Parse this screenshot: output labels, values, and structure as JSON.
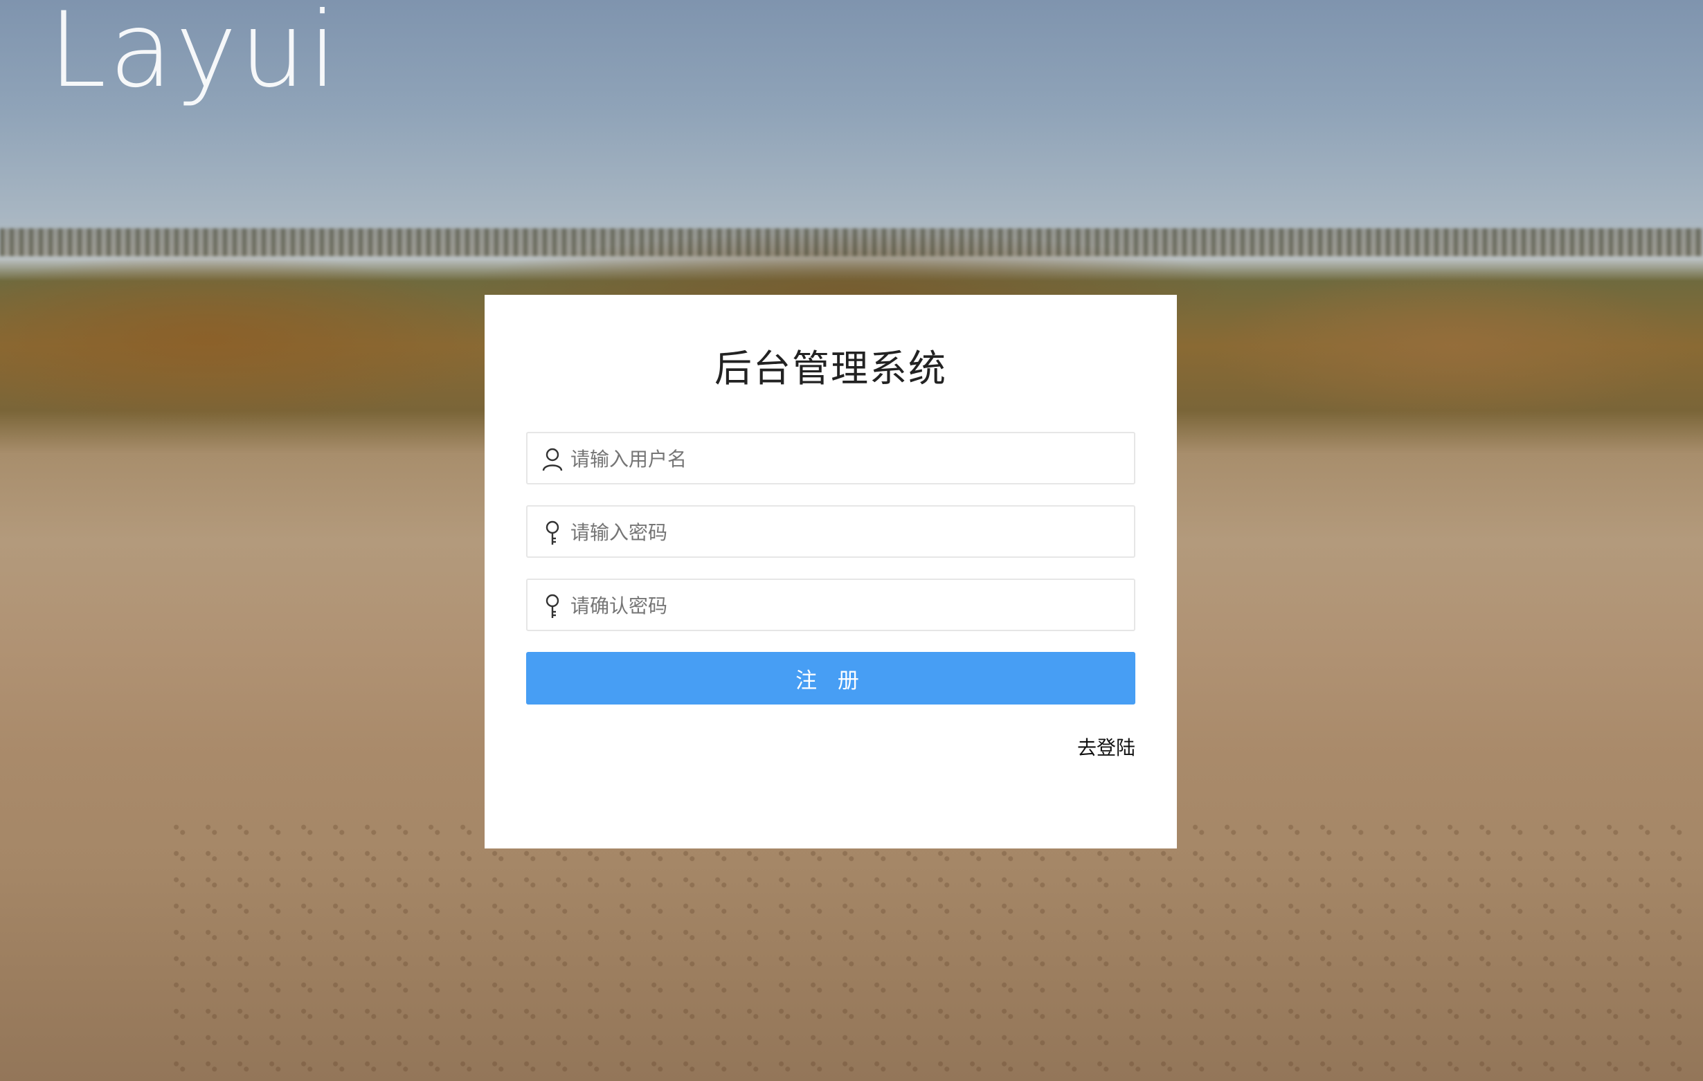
{
  "logo": {
    "text": "Layui"
  },
  "form": {
    "title": "后台管理系统",
    "username": {
      "placeholder": "请输入用户名",
      "icon": "user-icon"
    },
    "password": {
      "placeholder": "请输入密码",
      "icon": "key-icon"
    },
    "confirm_password": {
      "placeholder": "请确认密码",
      "icon": "key-icon"
    },
    "submit_label": "注 册",
    "login_link": "去登陆"
  },
  "colors": {
    "accent": "#479ef4",
    "card": "#ffffff"
  }
}
